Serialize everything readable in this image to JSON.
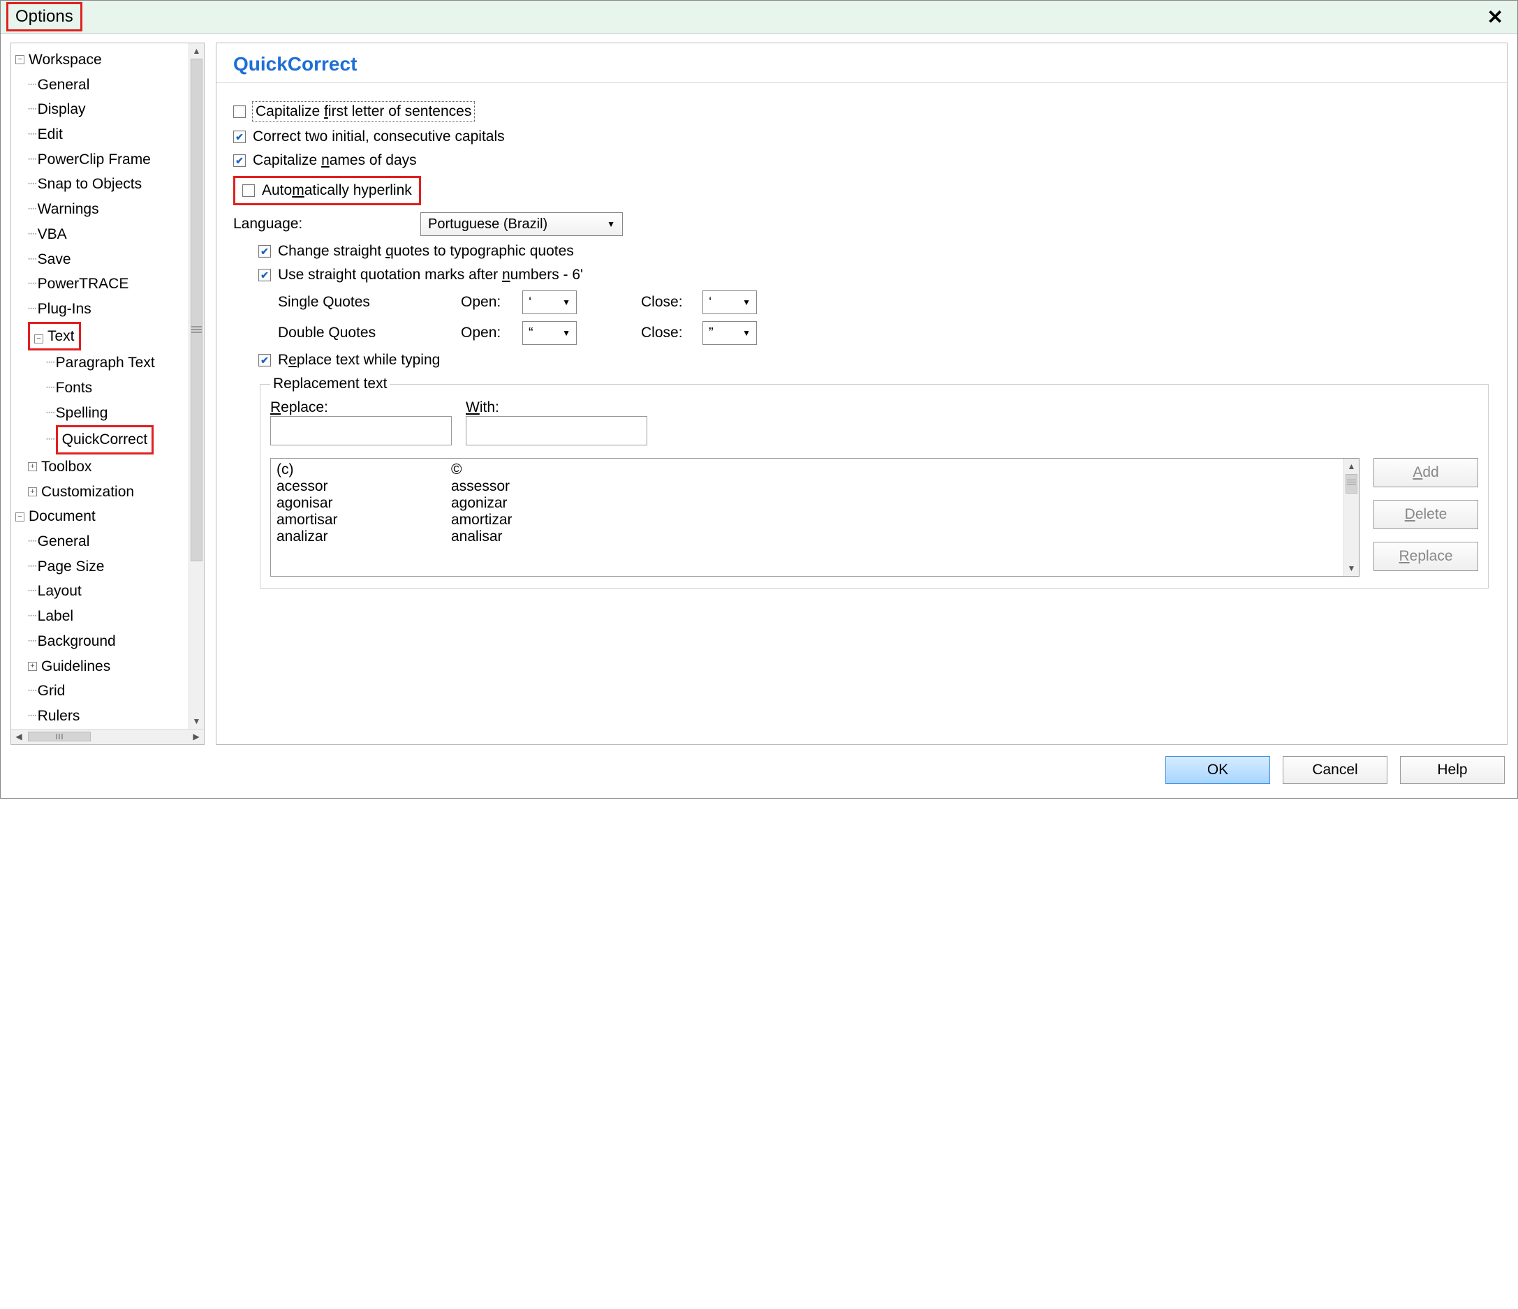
{
  "dialog_title": "Options",
  "tree": {
    "workspace": "Workspace",
    "workspace_children": [
      "General",
      "Display",
      "Edit",
      "PowerClip Frame",
      "Snap to Objects",
      "Warnings",
      "VBA",
      "Save",
      "PowerTRACE",
      "Plug-Ins"
    ],
    "text": "Text",
    "text_children": [
      "Paragraph Text",
      "Fonts",
      "Spelling",
      "QuickCorrect"
    ],
    "toolbox": "Toolbox",
    "customization": "Customization",
    "document": "Document",
    "document_children": [
      "General",
      "Page Size",
      "Layout",
      "Label",
      "Background"
    ],
    "guidelines": "Guidelines",
    "grid": "Grid",
    "rulers": "Rulers"
  },
  "panel": {
    "title": "QuickCorrect",
    "capitalize_first": "Capitalize first letter of sentences",
    "correct_two_caps": "Correct two initial, consecutive capitals",
    "capitalize_days": "Capitalize names of days",
    "auto_hyperlink": "Automatically hyperlink",
    "language_label": "Language:",
    "language_value": "Portuguese (Brazil)",
    "change_quotes": "Change straight quotes to typographic quotes",
    "use_straight_after_numbers": "Use straight quotation marks after numbers - 6'",
    "single_quotes": "Single Quotes",
    "double_quotes": "Double Quotes",
    "open_label": "Open:",
    "close_label": "Close:",
    "sq_open": "‘",
    "sq_close": "‘",
    "dq_open": "“",
    "dq_close": "”",
    "replace_while_typing": "Replace text while typing",
    "replacement_legend": "Replacement text",
    "replace_label": "Replace:",
    "with_label": "With:",
    "list": [
      {
        "r": "(c)",
        "w": "©"
      },
      {
        "r": "acessor",
        "w": "assessor"
      },
      {
        "r": "agonisar",
        "w": "agonizar"
      },
      {
        "r": "amortisar",
        "w": "amortizar"
      },
      {
        "r": "analizar",
        "w": "analisar"
      }
    ],
    "btn_add": "Add",
    "btn_delete": "Delete",
    "btn_replace": "Replace"
  },
  "buttons": {
    "ok": "OK",
    "cancel": "Cancel",
    "help": "Help"
  }
}
